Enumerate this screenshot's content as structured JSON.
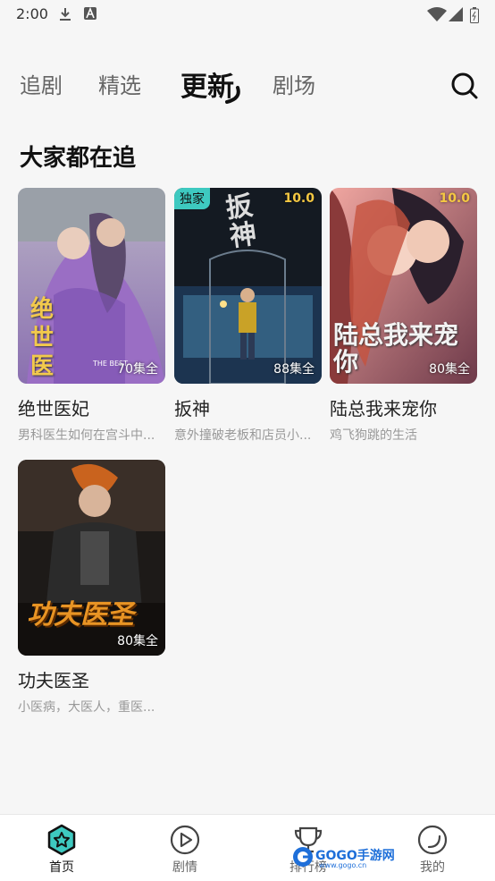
{
  "status_bar": {
    "time": "2:00",
    "icons": [
      "download-icon",
      "a-icon",
      "wifi-icon",
      "signal-icon",
      "battery-icon"
    ]
  },
  "top_tabs": [
    {
      "label": "追剧",
      "active": false
    },
    {
      "label": "精选",
      "active": false
    },
    {
      "label": "更新",
      "active": true
    },
    {
      "label": "剧场",
      "active": false
    }
  ],
  "section": {
    "title": "大家都在追",
    "cards": [
      {
        "title": "绝世医妃",
        "desc": "男科医生如何在宫斗中...",
        "episodes": "70集全",
        "poster_text": "绝世医",
        "poster_small": "THE BEST"
      },
      {
        "title": "扳神",
        "desc": "意外撞破老板和店员小...",
        "episodes": "88集全",
        "score": "10.0",
        "badge": "独家",
        "poster_text": "扳神"
      },
      {
        "title": "陆总我来宠你",
        "desc": "鸡飞狗跳的生活",
        "episodes": "80集全",
        "score": "10.0",
        "poster_text": "陆总我来宠你"
      },
      {
        "title": "功夫医圣",
        "desc": "小医病，大医人，重医...",
        "episodes": "80集全",
        "poster_text": "功夫医圣"
      }
    ]
  },
  "bottom_nav": [
    {
      "label": "首页",
      "icon": "home-star-icon",
      "active": true
    },
    {
      "label": "剧情",
      "icon": "play-circle-icon",
      "active": false
    },
    {
      "label": "排行榜",
      "icon": "trophy-icon",
      "active": false
    },
    {
      "label": "我的",
      "icon": "profile-circle-icon",
      "active": false
    }
  ],
  "watermark": {
    "text": "GOGO手游网",
    "sub": "www.gogo.cn"
  },
  "colors": {
    "accent": "#3ec9c0",
    "score": "#f5c842",
    "background": "#f6f6f6"
  }
}
